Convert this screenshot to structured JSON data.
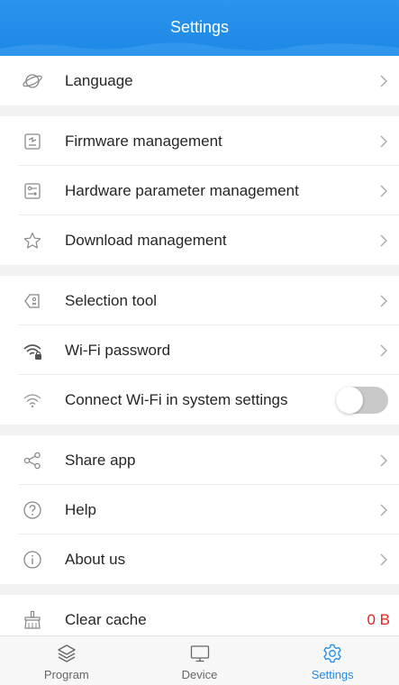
{
  "header": {
    "title": "Settings"
  },
  "colors": {
    "accent": "#1e8bea",
    "cache_value": "#e8231b",
    "toggle_off": "#c9c9c9"
  },
  "groups": [
    [
      {
        "id": "language",
        "label": "Language",
        "icon": "globe-icon"
      }
    ],
    [
      {
        "id": "firmware",
        "label": "Firmware management",
        "icon": "firmware-icon"
      },
      {
        "id": "hardware",
        "label": "Hardware parameter management",
        "icon": "hardware-params-icon"
      },
      {
        "id": "download",
        "label": "Download management",
        "icon": "star-icon"
      }
    ],
    [
      {
        "id": "selection",
        "label": "Selection tool",
        "icon": "tag-icon"
      },
      {
        "id": "wifi-password",
        "label": "Wi-Fi password",
        "icon": "wifi-lock-icon"
      },
      {
        "id": "wifi-system",
        "label": "Connect Wi-Fi in system settings",
        "icon": "wifi-icon",
        "toggle_on": false
      }
    ],
    [
      {
        "id": "share",
        "label": "Share app",
        "icon": "share-icon"
      },
      {
        "id": "help",
        "label": "Help",
        "icon": "help-icon"
      },
      {
        "id": "about",
        "label": "About us",
        "icon": "info-icon"
      }
    ],
    [
      {
        "id": "clear-cache",
        "label": "Clear cache",
        "icon": "broom-icon",
        "value": "0 B"
      }
    ]
  ],
  "tabbar": {
    "tabs": [
      {
        "label": "Program",
        "icon": "layers-icon",
        "active": false
      },
      {
        "label": "Device",
        "icon": "monitor-icon",
        "active": false
      },
      {
        "label": "Settings",
        "icon": "gear-icon",
        "active": true
      }
    ]
  }
}
